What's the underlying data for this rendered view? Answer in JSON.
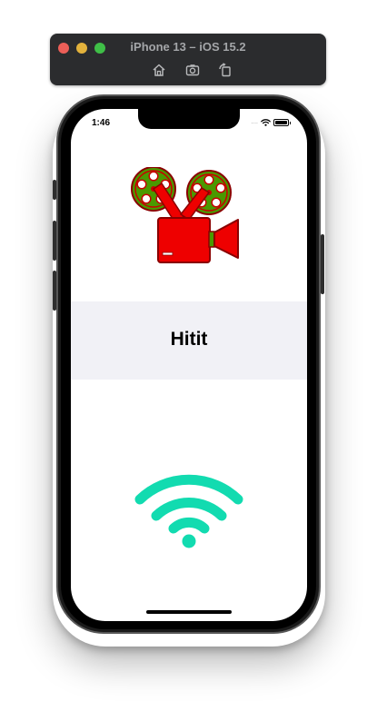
{
  "simulator": {
    "title": "iPhone 13 – iOS 15.2",
    "window_controls": [
      "close",
      "minimize",
      "zoom"
    ],
    "toolbar_icons": [
      "home-icon",
      "screenshot-icon",
      "rotate-icon"
    ]
  },
  "status_bar": {
    "time": "1:46",
    "signal_text": "....",
    "icons": [
      "wifi-status-icon",
      "battery-icon"
    ]
  },
  "app": {
    "header_icon": "film-camera-icon",
    "title": "Hitit",
    "connection_icon": "wifi-icon"
  },
  "colors": {
    "camera_body": "#ee0000",
    "camera_reel": "#4a9900",
    "wifi": "#12dbb0",
    "title_band": "#f1f1f6",
    "traffic_red": "#ec5f58",
    "traffic_yellow": "#e3b23c",
    "traffic_green": "#3fbf47"
  }
}
